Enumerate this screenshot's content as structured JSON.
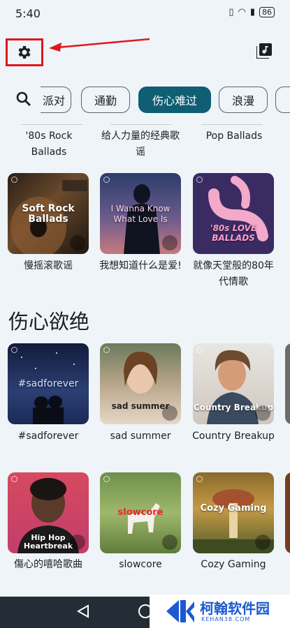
{
  "status": {
    "time": "5:40",
    "battery": "86"
  },
  "chips": [
    "派对",
    "通勤",
    "伤心难过",
    "浪漫"
  ],
  "top_captions": [
    "'80s Rock Ballads",
    "给人力量的经典歌谣",
    "Pop Ballads"
  ],
  "row1": [
    {
      "art": "Soft Rock Ballads",
      "caption": "慢摇滚歌谣"
    },
    {
      "art": "I Wanna Know What Love Is",
      "caption": "我想知道什么是爱!"
    },
    {
      "art": "'80s LOVE BALLADS",
      "caption": "就像天堂般的80年代情歌"
    }
  ],
  "section_title": "伤心欲绝",
  "row2": [
    {
      "art": "#sadforever",
      "caption": "#sadforever"
    },
    {
      "art": "sad summer",
      "caption": "sad summer"
    },
    {
      "art": "Country Breakup",
      "caption": "Country Breakup"
    }
  ],
  "row3": [
    {
      "art": "Hip Hop Heartbreak",
      "caption": "傷心的嘻哈歌曲"
    },
    {
      "art": "slowcore",
      "caption": "slowcore"
    },
    {
      "art": "Cozy Gaming",
      "caption": "Cozy Gaming"
    }
  ],
  "watermark": {
    "title": "柯翰软件园",
    "url": "KEHAN38.COM"
  },
  "colors": {
    "accent": "#0f5e73",
    "highlight": "#e0161d"
  }
}
